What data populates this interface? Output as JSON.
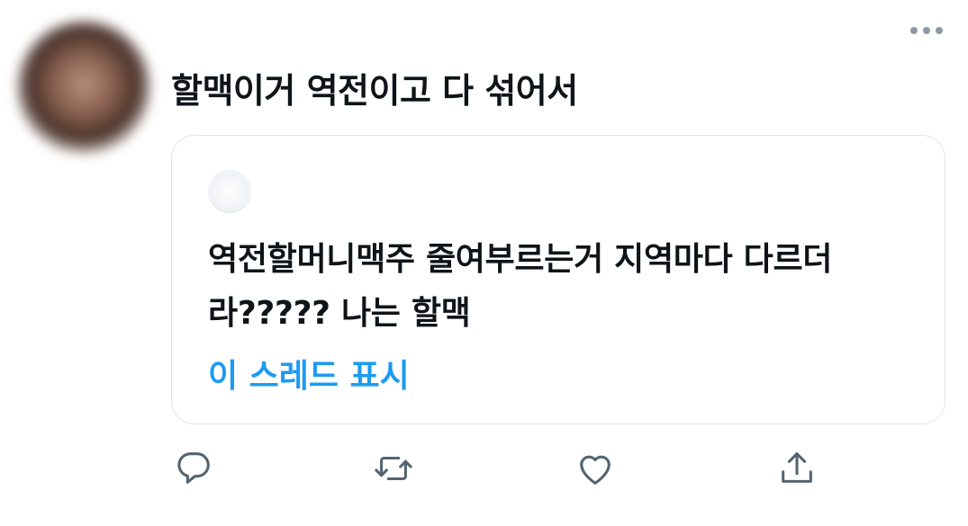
{
  "tweet": {
    "text": "할맥이거 역전이고 다 섞어서"
  },
  "quote": {
    "text": "역전할머니맥주 줄여부르는거 지역마다 다르더라????? 나는 할맥",
    "show_thread_label": "이 스레드 표시"
  },
  "actions": [
    {
      "icon": "reply-icon"
    },
    {
      "icon": "retweet-icon"
    },
    {
      "icon": "like-icon"
    },
    {
      "icon": "share-icon"
    }
  ],
  "colors": {
    "accent": "#1d9bf0",
    "icon": "#536471",
    "text": "#0f1419",
    "border": "#e1e5e8"
  }
}
